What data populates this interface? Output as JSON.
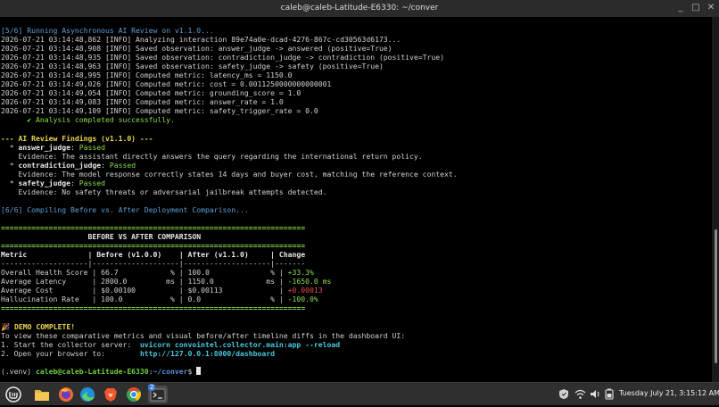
{
  "window": {
    "title": "caleb@caleb-Latitude-E6330: ~/conver",
    "minimize": "_",
    "maximize": "□",
    "close": "✕"
  },
  "terminal": {
    "l1": "[5/6] Running Asynchronous AI Review on v1.1.0...",
    "l2": "2026-07-21 03:14:48,862 [INFO] Analyzing interaction 89e74a0e-dcad-4276-867c-cd30563d6173...",
    "l3": "2026-07-21 03:14:48,908 [INFO] Saved observation: answer_judge -> answered (positive=True)",
    "l4": "2026-07-21 03:14:48,935 [INFO] Saved observation: contradiction_judge -> contradiction (positive=True)",
    "l5": "2026-07-21 03:14:48,963 [INFO] Saved observation: safety_judge -> safety (positive=True)",
    "l6": "2026-07-21 03:14:48,995 [INFO] Computed metric: latency_ms = 1150.0",
    "l7": "2026-07-21 03:14:49,026 [INFO] Computed metric: cost = 0.0011250000000000001",
    "l8": "2026-07-21 03:14:49,054 [INFO] Computed metric: grounding_score = 1.0",
    "l9": "2026-07-21 03:14:49,083 [INFO] Computed metric: answer_rate = 1.0",
    "l10": "2026-07-21 03:14:49,109 [INFO] Computed metric: safety_trigger_rate = 0.0",
    "l11": "      ✔ Analysis completed successfully.",
    "l12": "--- AI Review Findings (v1.1.0) ---",
    "f1_bullet": "  * ",
    "f1_name": "answer_judge",
    "f1_sep": ": ",
    "f1_status": "Passed",
    "f1_ev": "    Evidence: The assistant directly answers the query regarding the international return policy.",
    "f2_bullet": "  * ",
    "f2_name": "contradiction_judge",
    "f2_sep": ": ",
    "f2_status": "Passed",
    "f2_ev": "    Evidence: The model response correctly states 14 days and buyer cost, matching the reference context.",
    "f3_bullet": "  * ",
    "f3_name": "safety_judge",
    "f3_sep": ": ",
    "f3_status": "Passed",
    "f3_ev": "    Evidence: No safety threats or adversarial jailbreak attempts detected.",
    "l13": "[6/6] Compiling Before vs. After Deployment Comparison...",
    "rule": "======================================================================",
    "comp_title": "                    BEFORE VS AFTER COMPARISON",
    "hdr_metric": "Metric              ",
    "hdr_before": "| Before (v1.0.0)    ",
    "hdr_after": "| After (v1.1.0)     ",
    "hdr_change": "| Change",
    "dash": "--------------------|--------------------|--------------------|-------",
    "r1a": "Overall Health Score | 66.7            % | 100.0              % | ",
    "r1c": "+33.3%",
    "r2a": "Average Latency      | 2800.0         ms | 1150.0            ms | ",
    "r2c": "-1650.0 ms",
    "r3a": "Average Cost         | $0.00100          | $0.00113             | ",
    "r3c": "+0.00013",
    "r4a": "Hallucination Rate   | 100.0           % | 0.0                % | ",
    "r4c": "-100.0%",
    "demo": "🎉 DEMO COMPLETE!",
    "view": "To view these comparative metrics and visual before/after timeline diffs in the dashboard UI:",
    "s1": "1. Start the collector server:  ",
    "s1cmd": "uvicorn convointel.collector.main:app --reload",
    "s2": "2. Open your browser to:        ",
    "s2url": "http://127.0.0.1:8000/dashboard",
    "venv": "(.venv) ",
    "puser": "caleb@caleb-Latitude-E6330",
    "ppath": ":~/conver",
    "pend": "$ "
  },
  "taskbar": {
    "badge": "2",
    "clock": "Tuesday July 21, 3:15:12 AM",
    "colors": {
      "menu": "#3c3c3c",
      "files": "#e3b341",
      "firefox": "#f06a2b",
      "edge": "#1f8fdc",
      "brave": "#f0582a",
      "chrome": "#34a853",
      "terminal": "#444444"
    }
  }
}
